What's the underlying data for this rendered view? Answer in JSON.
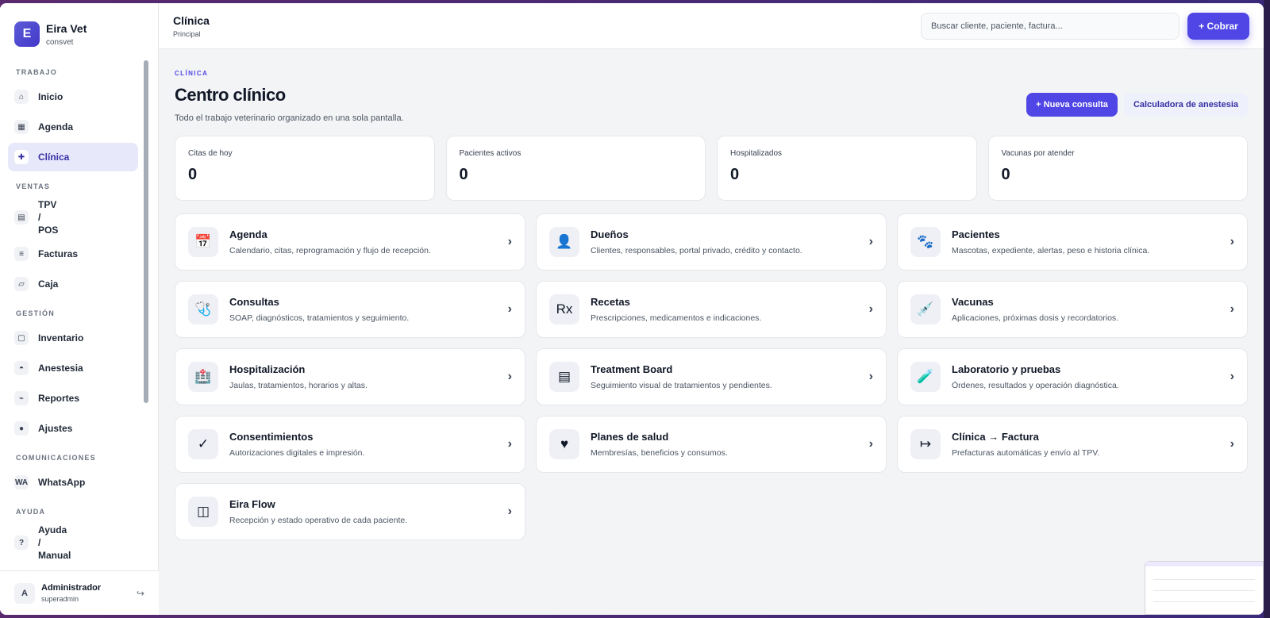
{
  "brand": {
    "logo_letter": "E",
    "name": "Eira Vet",
    "sub": "consvet"
  },
  "sidebar": {
    "sections": [
      {
        "title": "TRABAJO",
        "items": [
          {
            "label": "Inicio",
            "icon": "⌂",
            "icon_name": "home-icon"
          },
          {
            "label": "Agenda",
            "icon": "▦",
            "icon_name": "calendar-icon"
          },
          {
            "label": "Clínica",
            "icon": "✚",
            "icon_name": "clinic-icon",
            "active": true
          }
        ]
      },
      {
        "title": "VENTAS",
        "items": [
          {
            "label": "TPV / POS",
            "icon": "▤",
            "icon_name": "pos-icon"
          },
          {
            "label": "Facturas",
            "icon": "≡",
            "icon_name": "invoice-icon"
          },
          {
            "label": "Caja",
            "icon": "▱",
            "icon_name": "cash-icon"
          }
        ]
      },
      {
        "title": "GESTIÓN",
        "items": [
          {
            "label": "Inventario",
            "icon": "▢",
            "icon_name": "inventory-icon"
          },
          {
            "label": "Anestesia",
            "icon": "◓",
            "icon_name": "anesthesia-icon"
          },
          {
            "label": "Reportes",
            "icon": "⌁",
            "icon_name": "reports-icon"
          },
          {
            "label": "Ajustes",
            "icon": "●",
            "icon_name": "settings-icon"
          }
        ]
      },
      {
        "title": "COMUNICACIONES",
        "items": [
          {
            "label": "WhatsApp",
            "icon": "WA",
            "icon_name": "whatsapp-icon"
          }
        ]
      },
      {
        "title": "AYUDA",
        "items": [
          {
            "label": "Ayuda / Manual",
            "icon": "?",
            "icon_name": "help-icon"
          }
        ]
      }
    ]
  },
  "user": {
    "avatar": "A",
    "name": "Administrador",
    "role": "superadmin",
    "logout_icon": "↪"
  },
  "topbar": {
    "title": "Clínica",
    "sub": "Principal",
    "search_placeholder": "Buscar cliente, paciente, factura...",
    "cobrar_label": "+ Cobrar"
  },
  "page": {
    "eyebrow": "CLÍNICA",
    "title": "Centro clínico",
    "desc": "Todo el trabajo veterinario organizado en una sola pantalla.",
    "nueva_consulta": "+ Nueva consulta",
    "calculadora": "Calculadora de anestesia"
  },
  "stats": [
    {
      "label": "Citas de hoy",
      "value": "0"
    },
    {
      "label": "Pacientes activos",
      "value": "0"
    },
    {
      "label": "Hospitalizados",
      "value": "0"
    },
    {
      "label": "Vacunas por atender",
      "value": "0"
    }
  ],
  "modules": [
    {
      "title": "Agenda",
      "desc": "Calendario, citas, reprogramación y flujo de recepción.",
      "icon": "📅",
      "icon_name": "calendar-icon"
    },
    {
      "title": "Dueños",
      "desc": "Clientes, responsables, portal privado, crédito y contacto.",
      "icon": "👤",
      "icon_name": "owner-icon"
    },
    {
      "title": "Pacientes",
      "desc": "Mascotas, expediente, alertas, peso e historia clínica.",
      "icon": "🐾",
      "icon_name": "paw-icon"
    },
    {
      "title": "Consultas",
      "desc": "SOAP, diagnósticos, tratamientos y seguimiento.",
      "icon": "🩺",
      "icon_name": "stethoscope-icon"
    },
    {
      "title": "Recetas",
      "desc": "Prescripciones, medicamentos e indicaciones.",
      "icon": "Rx",
      "icon_name": "prescription-icon"
    },
    {
      "title": "Vacunas",
      "desc": "Aplicaciones, próximas dosis y recordatorios.",
      "icon": "💉",
      "icon_name": "syringe-icon"
    },
    {
      "title": "Hospitalización",
      "desc": "Jaulas, tratamientos, horarios y altas.",
      "icon": "🏥",
      "icon_name": "hospital-icon"
    },
    {
      "title": "Treatment Board",
      "desc": "Seguimiento visual de tratamientos y pendientes.",
      "icon": "▤",
      "icon_name": "board-icon"
    },
    {
      "title": "Laboratorio y pruebas",
      "desc": "Órdenes, resultados y operación diagnóstica.",
      "icon": "🧪",
      "icon_name": "test-tube-icon"
    },
    {
      "title": "Consentimientos",
      "desc": "Autorizaciones digitales e impresión.",
      "icon": "✓",
      "icon_name": "check-icon"
    },
    {
      "title": "Planes de salud",
      "desc": "Membresías, beneficios y consumos.",
      "icon": "♥",
      "icon_name": "heart-icon"
    },
    {
      "title": "Clínica → Factura",
      "desc": "Prefacturas automáticas y envío al TPV.",
      "icon": "↦",
      "icon_name": "arrow-icon"
    },
    {
      "title": "Eira Flow",
      "desc": "Recepción y estado operativo de cada paciente.",
      "icon": "◫",
      "icon_name": "flow-icon"
    }
  ],
  "chevron": "›"
}
